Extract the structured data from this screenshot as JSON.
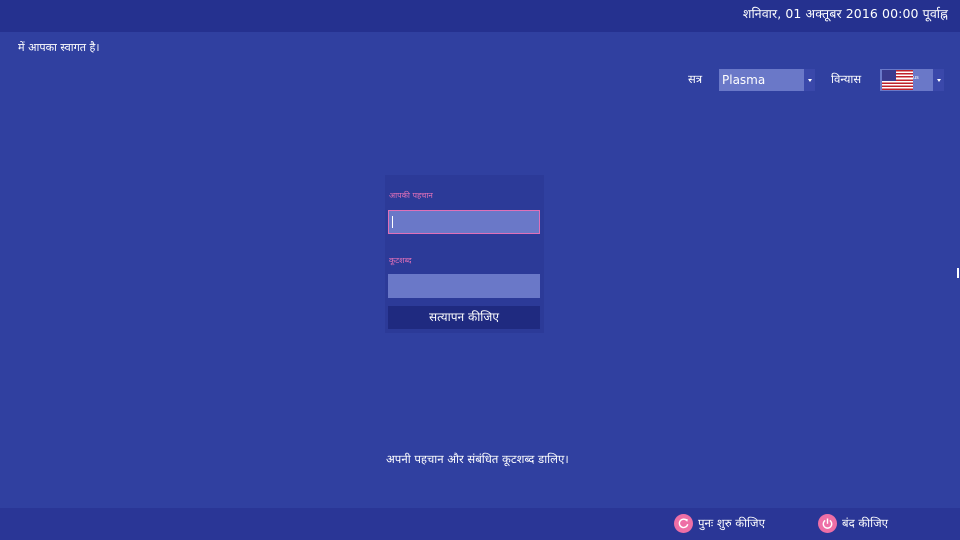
{
  "header": {
    "datetime": "शनिवार, 01 अक्तूबर 2016  00:00 पूर्वाह्न"
  },
  "welcome_text": "में आपका स्वागत है।",
  "session": {
    "label": "सत्र",
    "value": "Plasma"
  },
  "keyboard_layout": {
    "label": "विन्यास",
    "flag_icon": "us-flag-icon",
    "code": "us"
  },
  "login": {
    "username_label": "आपकी पहचान",
    "username_value": "",
    "password_label": "कूटशब्द",
    "password_value": "",
    "submit_label": "सत्यापन कीजिए"
  },
  "hint": "अपनी पहचान और संबंधित कूटशब्द डालिए।",
  "actions": {
    "reboot": {
      "label": "पुनः शुरु कीजिए",
      "icon": "restart-icon"
    },
    "shutdown": {
      "label": "बंद कीजिए",
      "icon": "power-icon"
    }
  },
  "colors": {
    "background": "#3040a0",
    "top_bar": "#25318f",
    "accent": "#e070b8",
    "input": "#6a78c8",
    "button": "#1f2a80",
    "action_icon": "#ee6fa6"
  }
}
